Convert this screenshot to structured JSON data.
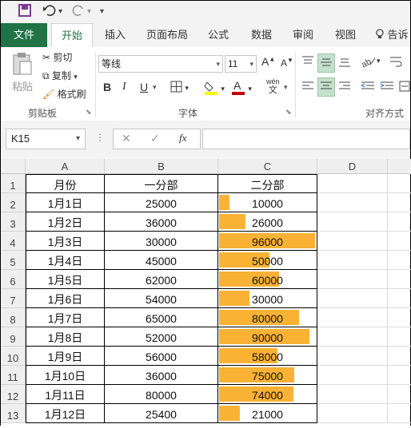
{
  "qat": {
    "save_icon": "save-icon",
    "undo_icon": "undo-icon",
    "redo_icon": "redo-icon",
    "customize_icon": "customize-icon"
  },
  "tabs": {
    "file": "文件",
    "home": "开始",
    "insert": "插入",
    "page_layout": "页面布局",
    "formulas": "公式",
    "data": "数据",
    "review": "审阅",
    "view": "视图",
    "tell_me": "告诉"
  },
  "ribbon": {
    "paste": "粘贴",
    "cut": "剪切",
    "copy": "复制",
    "format_painter": "格式刷",
    "clipboard": "剪贴板",
    "font_name": "等线",
    "font_size": "11",
    "font_group": "字体",
    "bold": "B",
    "italic": "I",
    "underline": "U",
    "phonetic": "wén",
    "phonetic_sub": "文",
    "grow": "A",
    "shrink": "A",
    "align_group": "对齐方式",
    "fill_color": "#ffff00",
    "font_color": "#c00000"
  },
  "formula_bar": {
    "name_box": "K15",
    "cancel": "✕",
    "enter": "✓",
    "fx": "fx",
    "value": ""
  },
  "columns": [
    "A",
    "B",
    "C",
    "D"
  ],
  "rows": [
    "1",
    "2",
    "3",
    "4",
    "5",
    "6",
    "7",
    "8",
    "9",
    "10",
    "11",
    "12",
    "13"
  ],
  "headers": {
    "a": "月份",
    "b": "一分部",
    "c": "二分部"
  },
  "table": [
    {
      "month": "1月1日",
      "b": "25000",
      "c": "10000",
      "c_val": 10000
    },
    {
      "month": "1月2日",
      "b": "36000",
      "c": "26000",
      "c_val": 26000
    },
    {
      "month": "1月3日",
      "b": "30000",
      "c": "96000",
      "c_val": 96000
    },
    {
      "month": "1月4日",
      "b": "45000",
      "c": "50000",
      "c_val": 50000
    },
    {
      "month": "1月5日",
      "b": "62000",
      "c": "60000",
      "c_val": 60000
    },
    {
      "month": "1月6日",
      "b": "54000",
      "c": "30000",
      "c_val": 30000
    },
    {
      "month": "1月7日",
      "b": "65000",
      "c": "80000",
      "c_val": 80000
    },
    {
      "month": "1月8日",
      "b": "52000",
      "c": "90000",
      "c_val": 90000
    },
    {
      "month": "1月9日",
      "b": "56000",
      "c": "58000",
      "c_val": 58000
    },
    {
      "month": "1月10日",
      "b": "36000",
      "c": "75000",
      "c_val": 75000
    },
    {
      "month": "1月11日",
      "b": "80000",
      "c": "74000",
      "c_val": 74000
    },
    {
      "month": "1月12日",
      "b": "25400",
      "c": "21000",
      "c_val": 21000
    }
  ],
  "databar": {
    "color": "#f9b234",
    "max": 96000
  }
}
